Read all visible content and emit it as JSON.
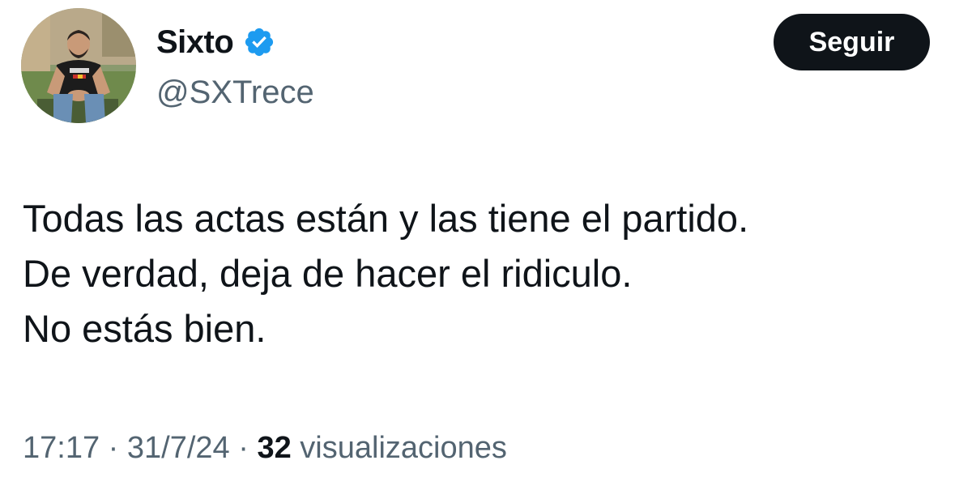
{
  "author": {
    "display_name": "Sixto",
    "handle": "@SXTrece",
    "verified_icon": "verified-badge-icon",
    "avatar_icon": "profile-photo"
  },
  "follow_button": {
    "label": "Seguir"
  },
  "tweet": {
    "lines": [
      "Todas las actas están y las tiene el partido.",
      "De verdad, deja de hacer el ridiculo.",
      "No estás bien."
    ]
  },
  "meta": {
    "time": "17:17",
    "separator": " · ",
    "date": "31/7/24",
    "views_count": "32",
    "views_label": " visualizaciones"
  },
  "colors": {
    "verified_blue": "#1d9bf0",
    "text_primary": "#0f1419",
    "text_secondary": "#536471",
    "button_bg": "#0f1419",
    "button_text": "#ffffff"
  }
}
